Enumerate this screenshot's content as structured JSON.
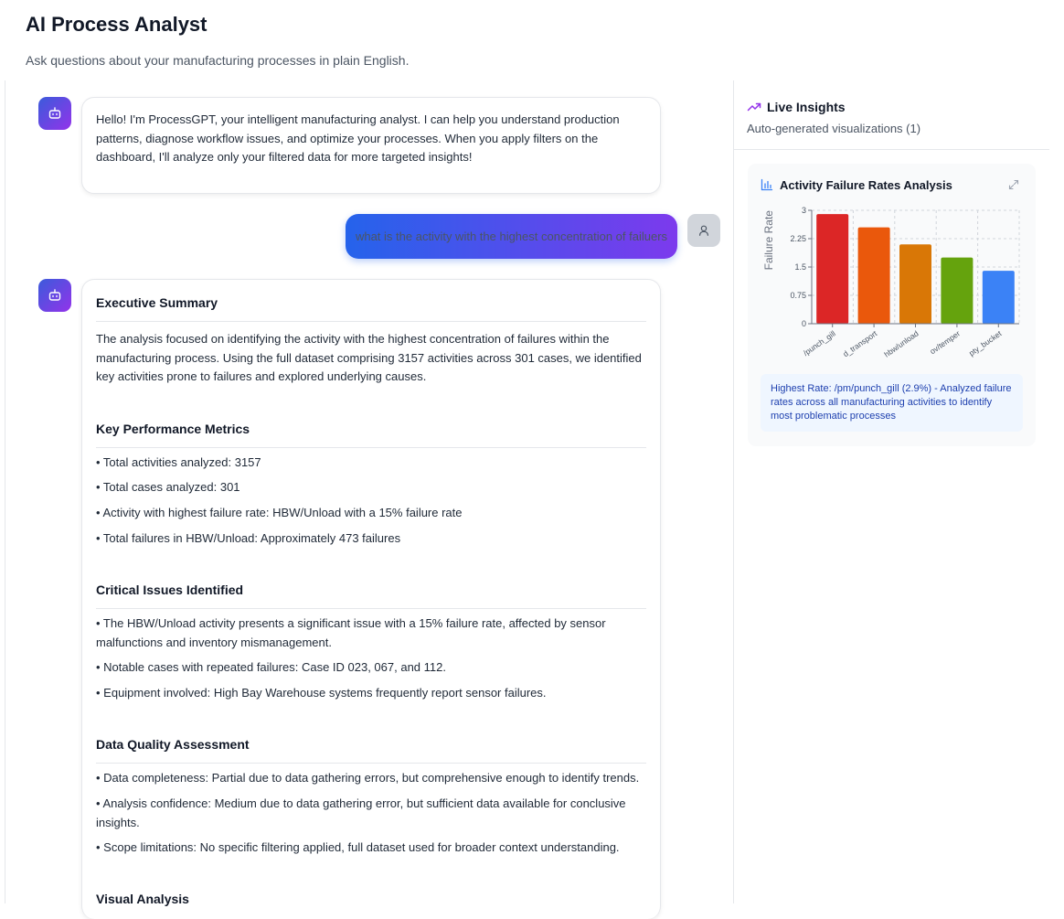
{
  "header": {
    "title": "AI Process Analyst",
    "subtitle": "Ask questions about your manufacturing processes in plain English."
  },
  "chat": {
    "welcome": "Hello! I'm ProcessGPT, your intelligent manufacturing analyst. I can help you understand production patterns, diagnose workflow issues, and optimize your processes. When you apply filters on the dashboard, I'll analyze only your filtered data for more targeted insights!",
    "user_message": "what is the activity with the highest concentration of failuers",
    "response": {
      "executive_summary": {
        "title": "Executive Summary",
        "text": "The analysis focused on identifying the activity with the highest concentration of failures within the manufacturing process. Using the full dataset comprising 3157 activities across 301 cases, we identified key activities prone to failures and explored underlying causes."
      },
      "key_metrics": {
        "title": "Key Performance Metrics",
        "items": [
          "• Total activities analyzed: 3157",
          "• Total cases analyzed: 301",
          "• Activity with highest failure rate: HBW/Unload with a 15% failure rate",
          "• Total failures in HBW/Unload: Approximately 473 failures"
        ]
      },
      "critical_issues": {
        "title": "Critical Issues Identified",
        "items": [
          "• The HBW/Unload activity presents a significant issue with a 15% failure rate, affected by sensor malfunctions and inventory mismanagement.",
          "• Notable cases with repeated failures: Case ID 023, 067, and 112.",
          "• Equipment involved: High Bay Warehouse systems frequently report sensor failures."
        ]
      },
      "data_quality": {
        "title": "Data Quality Assessment",
        "items": [
          "• Data completeness: Partial due to data gathering errors, but comprehensive enough to identify trends.",
          "• Analysis confidence: Medium due to data gathering error, but sufficient data available for conclusive insights.",
          "• Scope limitations: No specific filtering applied, full dataset used for broader context understanding."
        ]
      },
      "visual_analysis": {
        "title": "Visual Analysis"
      }
    }
  },
  "insights": {
    "title": "Live Insights",
    "subtitle": "Auto-generated visualizations (1)",
    "card_title": "Activity Failure Rates Analysis",
    "note": "Highest Rate: /pm/punch_gill (2.9%) - Analyzed failure rates across all manufacturing activities to identify most problematic processes"
  },
  "chart_data": {
    "type": "bar",
    "title": "Activity Failure Rates Analysis",
    "ylabel": "Failure Rate",
    "categories": [
      "/punch_gill",
      "d_transport",
      "hbw/unload",
      "ov/temper",
      "pty_bucket"
    ],
    "values": [
      2.9,
      2.55,
      2.1,
      1.75,
      1.4
    ],
    "colors": [
      "#dc2626",
      "#ea580c",
      "#d97706",
      "#65a30d",
      "#3b82f6"
    ],
    "yticks": [
      "0",
      "0.75",
      "1.5",
      "2.25",
      "3"
    ],
    "ylim": [
      0,
      3
    ],
    "grid": true
  },
  "icons": {
    "bot": "bot-icon",
    "user": "user-icon",
    "trend": "trending-up-icon",
    "bar_chart": "bar-chart-icon",
    "expand": "expand-icon"
  }
}
